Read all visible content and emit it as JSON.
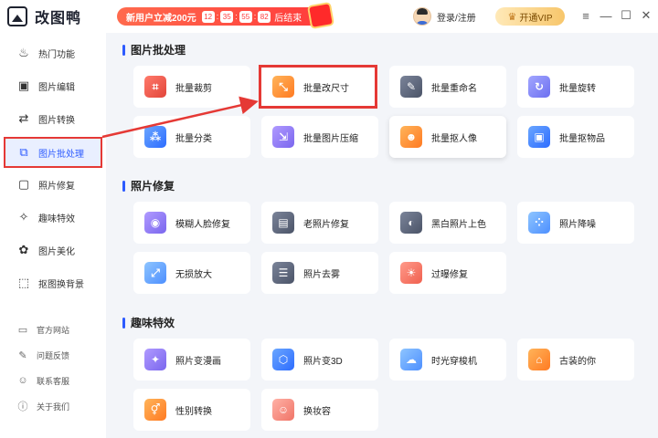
{
  "app": {
    "name": "改图鸭",
    "promo_text": "新用户立减200元",
    "countdown": [
      "12",
      "35",
      "55",
      "82"
    ],
    "promo_end": "后结束",
    "login": "登录/注册",
    "vip": "开通VIP",
    "controls": {
      "menu": "≡",
      "minimize": "—",
      "maximize": "☐",
      "close": "✕"
    }
  },
  "sidebar": {
    "items": [
      {
        "label": "热门功能",
        "icon": "flame-icon"
      },
      {
        "label": "图片编辑",
        "icon": "image-edit-icon"
      },
      {
        "label": "图片转换",
        "icon": "convert-icon"
      },
      {
        "label": "图片批处理",
        "icon": "batch-icon"
      },
      {
        "label": "照片修复",
        "icon": "photo-repair-icon"
      },
      {
        "label": "趣味特效",
        "icon": "magic-icon"
      },
      {
        "label": "图片美化",
        "icon": "beautify-icon"
      },
      {
        "label": "抠图换背景",
        "icon": "cutout-icon"
      }
    ],
    "footer": [
      {
        "label": "官方网站",
        "icon": "monitor-icon"
      },
      {
        "label": "问题反馈",
        "icon": "feedback-icon"
      },
      {
        "label": "联系客服",
        "icon": "headset-icon"
      },
      {
        "label": "关于我们",
        "icon": "info-icon"
      }
    ]
  },
  "sections": {
    "batch": {
      "title": "图片批处理",
      "cards": [
        "批量裁剪",
        "批量改尺寸",
        "批量重命名",
        "批量旋转",
        "批量分类",
        "批量图片压缩",
        "批量抠人像",
        "批量抠物品"
      ]
    },
    "repair": {
      "title": "照片修复",
      "cards": [
        "模糊人脸修复",
        "老照片修复",
        "黑白照片上色",
        "照片降噪",
        "无损放大",
        "照片去雾",
        "过曝修复"
      ]
    },
    "fun": {
      "title": "趣味特效",
      "cards": [
        "照片变漫画",
        "照片变3D",
        "时光穿梭机",
        "古装的你",
        "性别转换",
        "换妆容"
      ]
    }
  },
  "colors": {
    "accent": "#2d5bff",
    "highlight": "#e53935"
  }
}
